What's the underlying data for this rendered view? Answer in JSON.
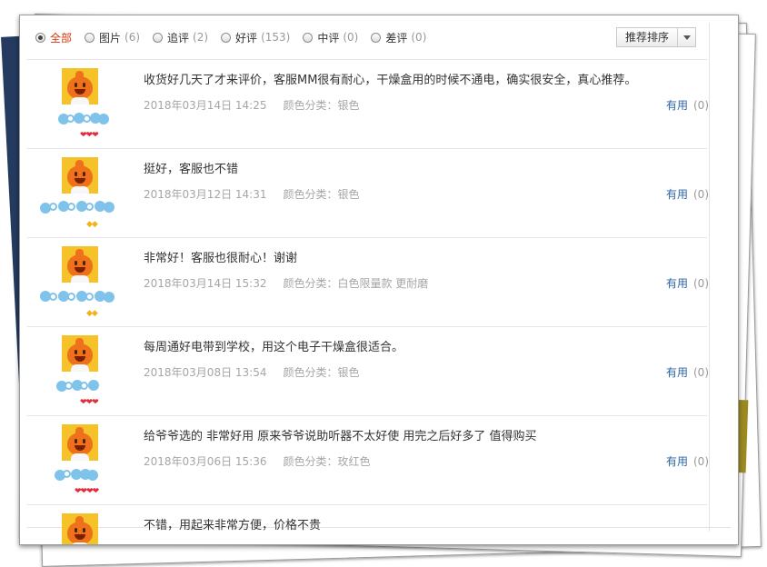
{
  "filters": [
    {
      "label": "全部",
      "count": "",
      "selected": true
    },
    {
      "label": "图片",
      "count": "(6)",
      "selected": false
    },
    {
      "label": "追评",
      "count": "(2)",
      "selected": false
    },
    {
      "label": "好评",
      "count": "(153)",
      "selected": false
    },
    {
      "label": "中评",
      "count": "(0)",
      "selected": false
    },
    {
      "label": "差评",
      "count": "(0)",
      "selected": false
    }
  ],
  "sort": {
    "label": "推荐排序"
  },
  "useful_label": "有用",
  "reviews": [
    {
      "text": "收货好几天了才来评价，客服MM很有耐心，干燥盒用的时候不通电，确实很安全，真心推荐。",
      "date": "2018年03月14日 14:25",
      "sku": "颜色分类：银色",
      "useful_count": "(0)",
      "level_icon": "heart",
      "level_marks": "❤❤❤"
    },
    {
      "text": "挺好，客服也不错",
      "date": "2018年03月12日 14:31",
      "sku": "颜色分类：银色",
      "useful_count": "(0)",
      "level_icon": "diamond",
      "level_marks": "◆◆"
    },
    {
      "text": "非常好！客服也很耐心！谢谢",
      "date": "2018年03月14日 15:32",
      "sku": "颜色分类：白色限量款 更耐磨",
      "useful_count": "(0)",
      "level_icon": "diamond",
      "level_marks": "◆◆"
    },
    {
      "text": "每周通好电带到学校，用这个电子干燥盒很适合。",
      "date": "2018年03月08日 13:54",
      "sku": "颜色分类：银色",
      "useful_count": "(0)",
      "level_icon": "heart",
      "level_marks": "❤❤❤"
    },
    {
      "text": "给爷爷选的 非常好用 原来爷爷说助听器不太好使 用完之后好多了 值得购买",
      "date": "2018年03月06日 15:36",
      "sku": "颜色分类：玫红色",
      "useful_count": "(0)",
      "level_icon": "heart",
      "level_marks": "❤❤❤❤"
    },
    {
      "text": "不错，用起来非常方便，价格不贵",
      "date": "",
      "sku": "",
      "useful_count": "",
      "level_icon": "none",
      "level_marks": ""
    }
  ]
}
